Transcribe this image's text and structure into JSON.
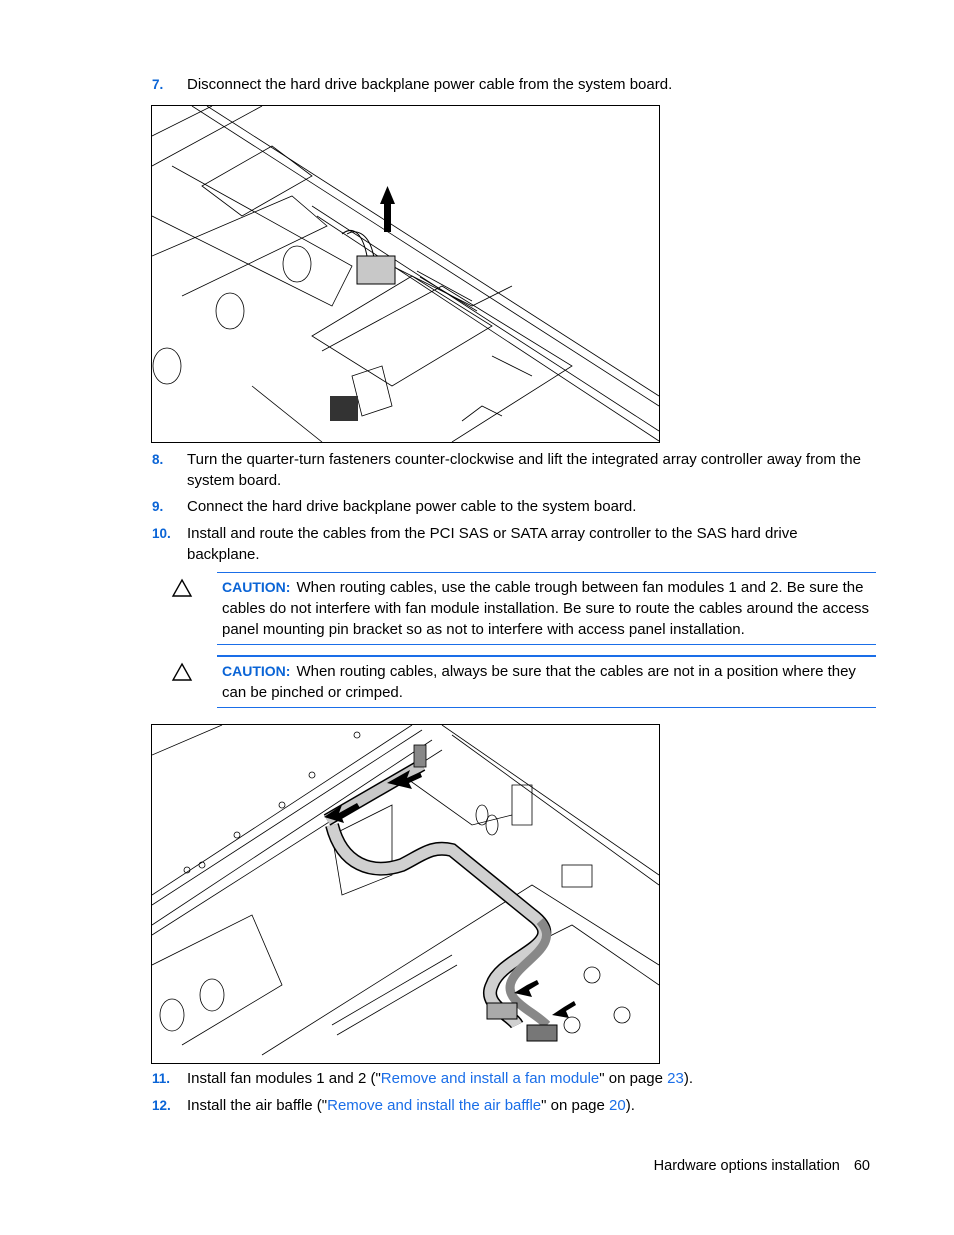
{
  "steps": [
    {
      "num": "7.",
      "text": "Disconnect the hard drive backplane power cable from the system board."
    },
    {
      "num": "8.",
      "text": "Turn the quarter-turn fasteners counter-clockwise and lift the integrated array controller away from the system board."
    },
    {
      "num": "9.",
      "text": "Connect the hard drive backplane power cable to the system board."
    },
    {
      "num": "10.",
      "text": "Install and route the cables from the PCI SAS or SATA array controller to the SAS hard drive backplane."
    },
    {
      "num": "11.",
      "prefix": "Install fan modules 1 and 2 (\"",
      "link": "Remove and install a fan module",
      "middle": "\" on page ",
      "page": "23",
      "suffix": ")."
    },
    {
      "num": "12.",
      "prefix": "Install the air baffle (\"",
      "link": "Remove and install the air baffle",
      "middle": "\" on page ",
      "page": "20",
      "suffix": ")."
    }
  ],
  "cautions": [
    {
      "label": "CAUTION:",
      "icon": "warning-triangle-icon",
      "text": "When routing cables, use the cable trough between fan modules 1 and 2. Be sure the cables do not interfere with fan module installation. Be sure to route the cables around the access panel mounting pin bracket so as not to interfere with access panel installation."
    },
    {
      "label": "CAUTION:",
      "icon": "warning-triangle-icon",
      "text": "When routing cables, always be sure that the cables are not in a position where they can be pinched or crimped."
    }
  ],
  "figures": [
    {
      "description": "Server chassis illustration: disconnecting hard drive backplane power cable (arrow pointing up)"
    },
    {
      "description": "Server chassis illustration: routing SAS cables from array controller to hard drive backplane"
    }
  ],
  "footer": {
    "section": "Hardware options installation",
    "page": "60"
  },
  "colors": {
    "accent": "#0a64d6",
    "link": "#1a6ee8",
    "rule": "#1a6ee8"
  }
}
